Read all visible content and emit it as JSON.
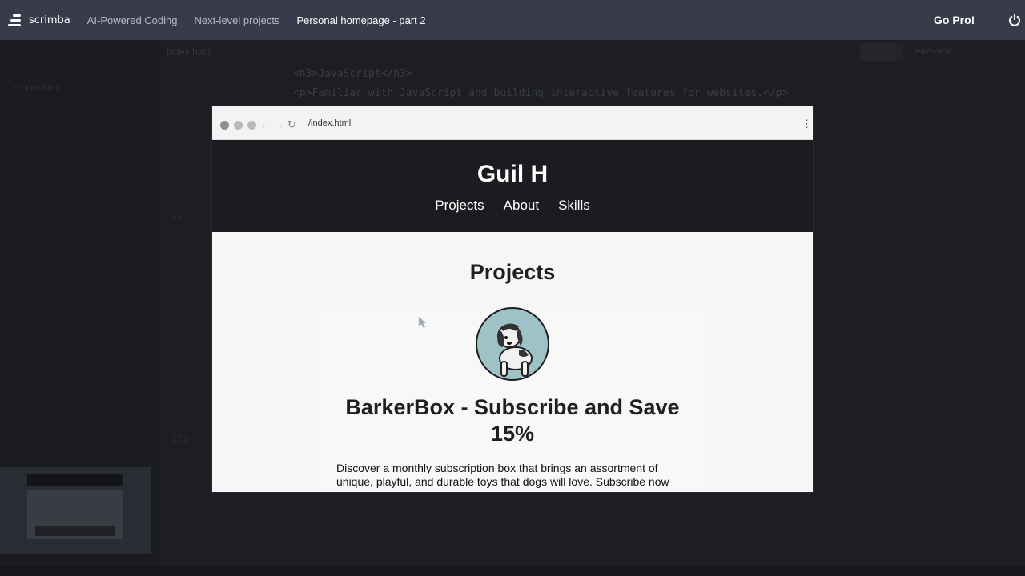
{
  "topbar": {
    "brand": "scrimba",
    "breadcrumbs": [
      "AI-Powered Coding",
      "Next-level projects",
      "Personal homepage - part 2"
    ],
    "go_pro": "Go Pro!"
  },
  "editor": {
    "tab_name": "index.html",
    "code_lines": [
      "<h3>JavaScript</h3>",
      "<p>Familiar with JavaScript and building interactive features for websites.</p>"
    ]
  },
  "browser": {
    "url": "/index.html"
  },
  "site": {
    "title": "Guil H",
    "nav": [
      "Projects",
      "About",
      "Skills"
    ],
    "section_title": "Projects",
    "project": {
      "image_icon": "dog-illustration-icon",
      "title": "BarkerBox - Subscribe and Save 15%",
      "description": "Discover a monthly subscription box that brings an assortment of unique, playful, and durable toys that dogs will love. Subscribe now"
    }
  },
  "colors": {
    "topbar": "#373b4a",
    "site_header": "#1a1c1f",
    "avatar_bg": "#9fc2c6"
  }
}
